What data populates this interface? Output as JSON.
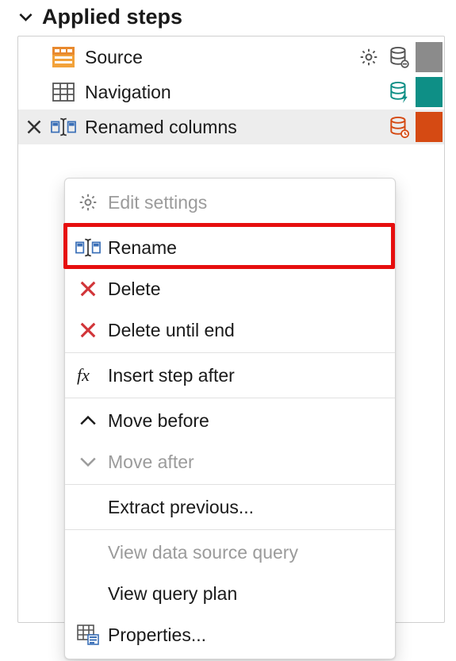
{
  "section": {
    "title": "Applied steps"
  },
  "steps": [
    {
      "label": "Source"
    },
    {
      "label": "Navigation"
    },
    {
      "label": "Renamed columns"
    }
  ],
  "menu": {
    "edit_settings": "Edit settings",
    "rename": "Rename",
    "delete": "Delete",
    "delete_until_end": "Delete until end",
    "insert_step_after": "Insert step after",
    "move_before": "Move before",
    "move_after": "Move after",
    "extract_previous": "Extract previous...",
    "view_data_source_query": "View data source query",
    "view_query_plan": "View query plan",
    "properties": "Properties..."
  }
}
